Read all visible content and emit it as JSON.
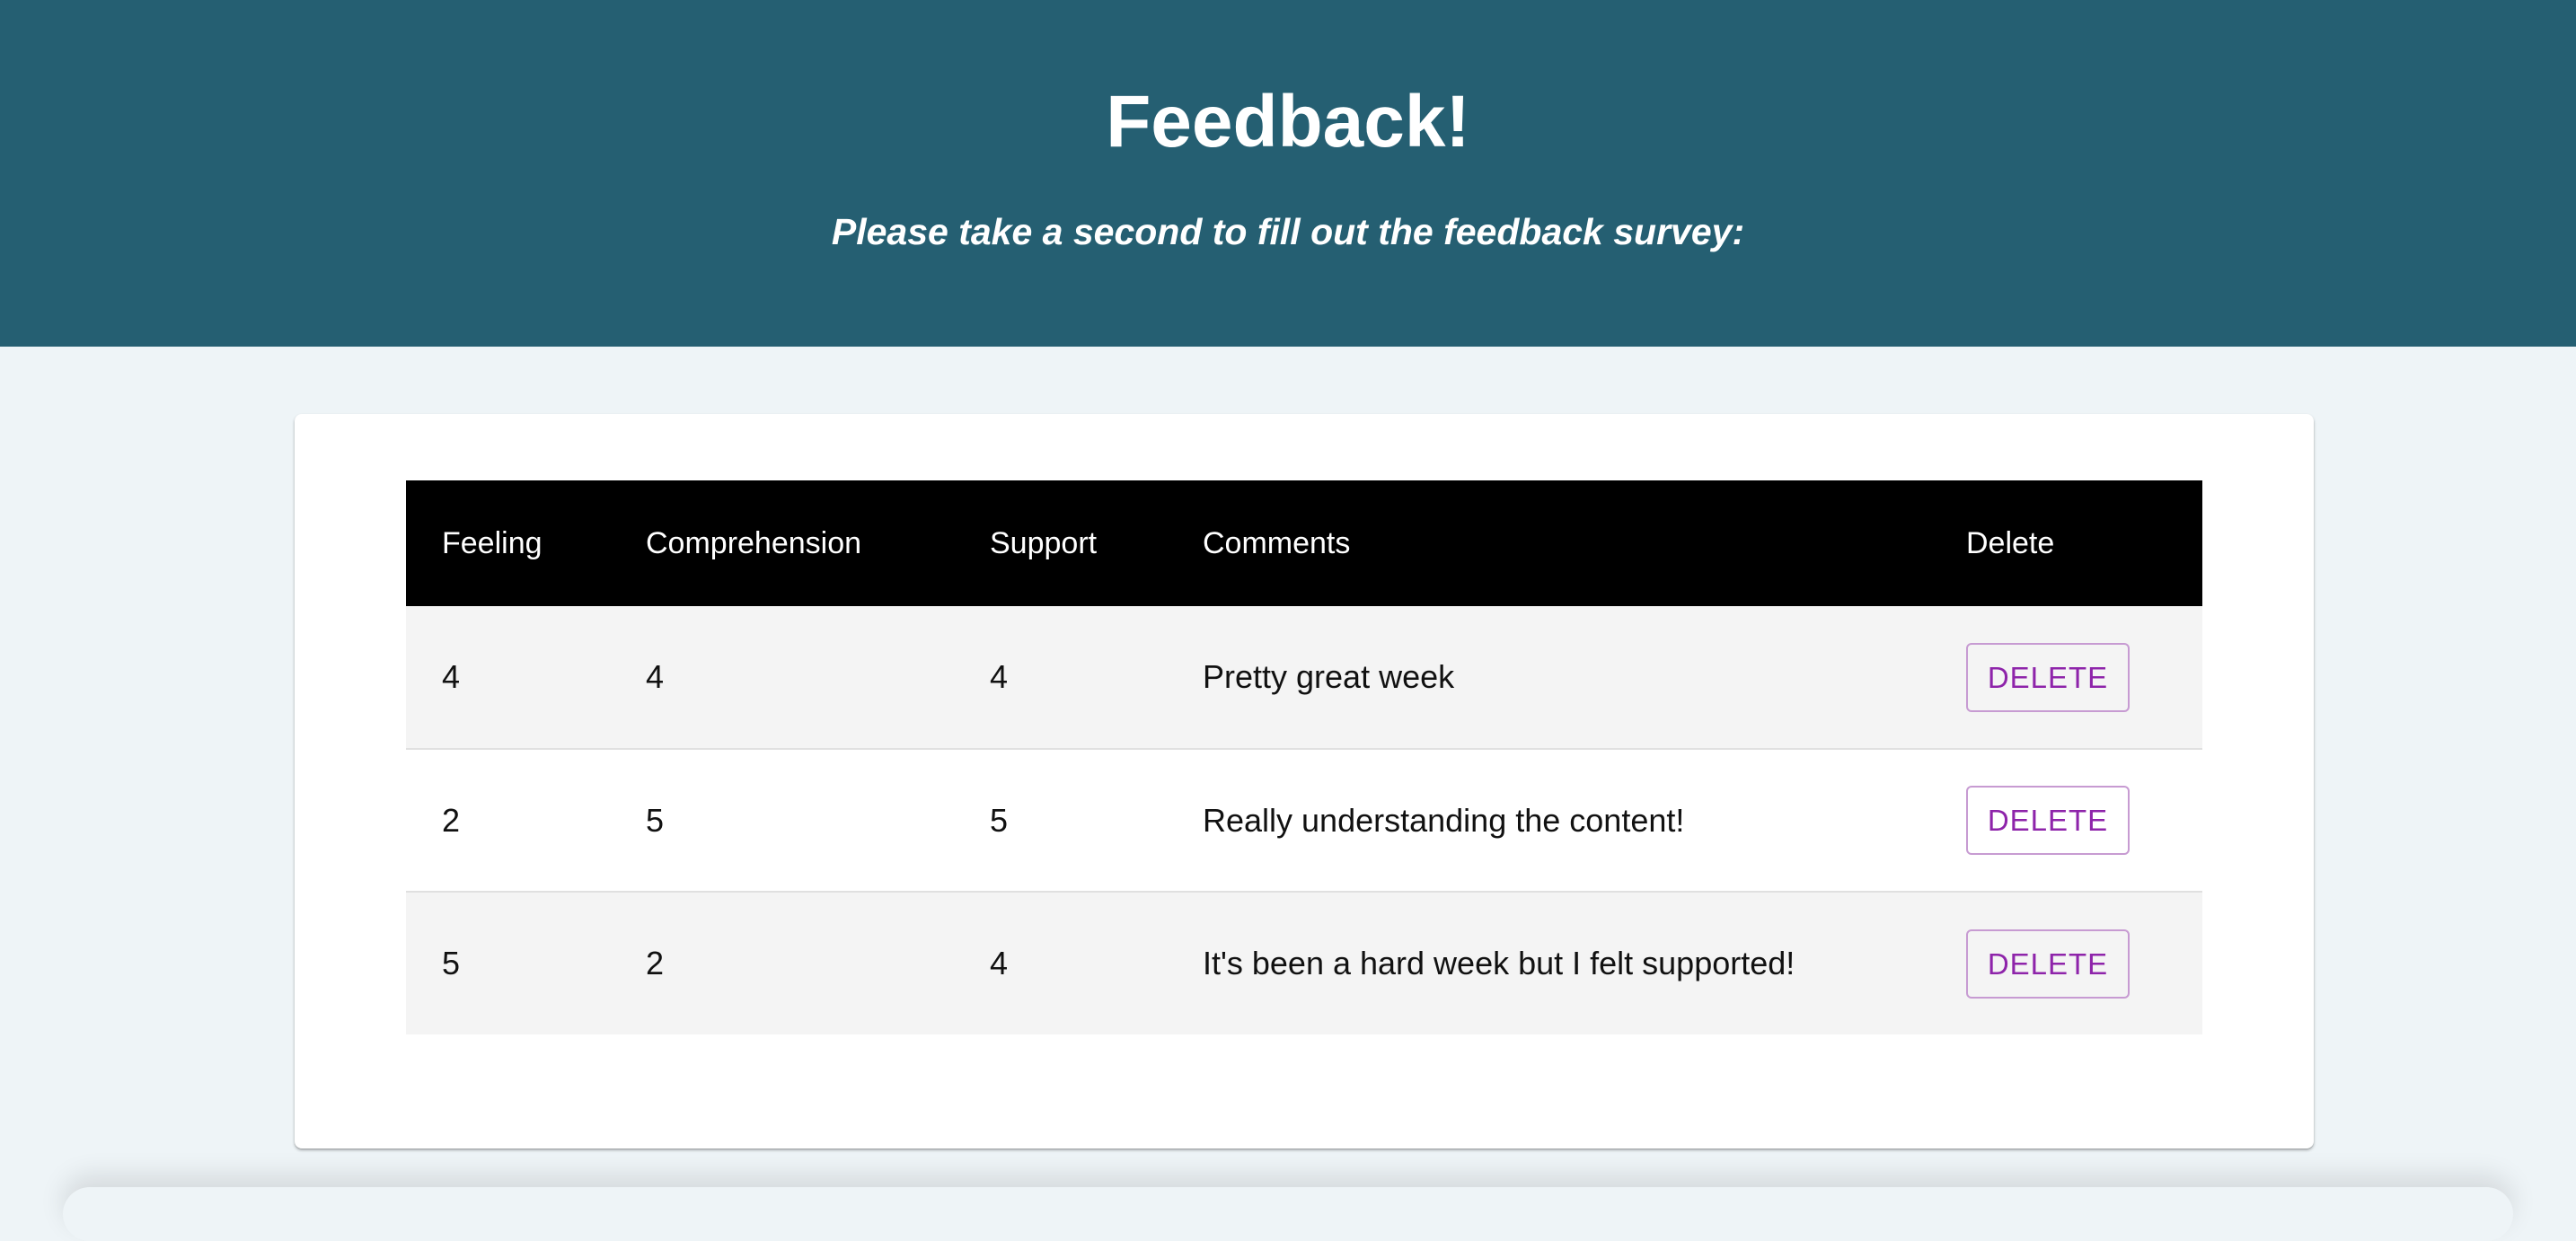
{
  "header": {
    "title": "Feedback!",
    "subtitle": "Please take a second to fill out the feedback survey:"
  },
  "colors": {
    "header_bg": "#255f72",
    "page_bg": "#eef4f7",
    "table_head_bg": "#000000",
    "delete_accent": "#8e24aa"
  },
  "table": {
    "columns": [
      "Feeling",
      "Comprehension",
      "Support",
      "Comments",
      "Delete"
    ],
    "rows": [
      {
        "feeling": "4",
        "comprehension": "4",
        "support": "4",
        "comments": "Pretty great week",
        "delete_label": "DELETE"
      },
      {
        "feeling": "2",
        "comprehension": "5",
        "support": "5",
        "comments": "Really understanding the content!",
        "delete_label": "DELETE"
      },
      {
        "feeling": "5",
        "comprehension": "2",
        "support": "4",
        "comments": "It's been a hard week but I felt supported!",
        "delete_label": "DELETE"
      }
    ]
  }
}
